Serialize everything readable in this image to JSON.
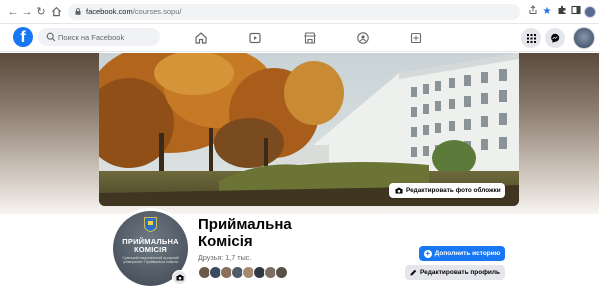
{
  "browser": {
    "back_icon": "arrow-left-icon",
    "forward_icon": "arrow-right-icon",
    "reload_icon": "reload-icon",
    "home_icon": "home-icon",
    "url_domain": "facebook.com",
    "url_path": "/courses.sopu/",
    "toolbar_icons": [
      "share-icon",
      "star-icon",
      "extensions-icon",
      "sidebar-icon",
      "profile-icon"
    ]
  },
  "facebook": {
    "search_placeholder": "Поиск на Facebook",
    "nav_tabs": [
      "home-icon",
      "video-icon",
      "marketplace-icon",
      "groups-icon",
      "gaming-icon"
    ],
    "right_buttons": [
      "menu-grid-icon",
      "messenger-icon",
      "notifications-icon",
      "account-avatar"
    ]
  },
  "cover": {
    "edit_cover_label": "Редактировать фото обложки"
  },
  "profile": {
    "picture_title": "ПРИЙМАЛЬНА КОМІСІЯ",
    "picture_subtitle": "Сумський національний аграрний університет. Приймальна комісія",
    "name_line1": "Приймальна",
    "name_line2": "Комісія",
    "friends_text": "Друзья: 1,7 тыс.",
    "friend_avatar_count": 8,
    "add_story_label": "Дополнить историю",
    "edit_profile_label": "Редактировать профиль"
  },
  "colors": {
    "facebook_blue": "#1877f2",
    "button_gray": "#e4e6eb",
    "text_primary": "#050505",
    "text_secondary": "#65676b"
  }
}
